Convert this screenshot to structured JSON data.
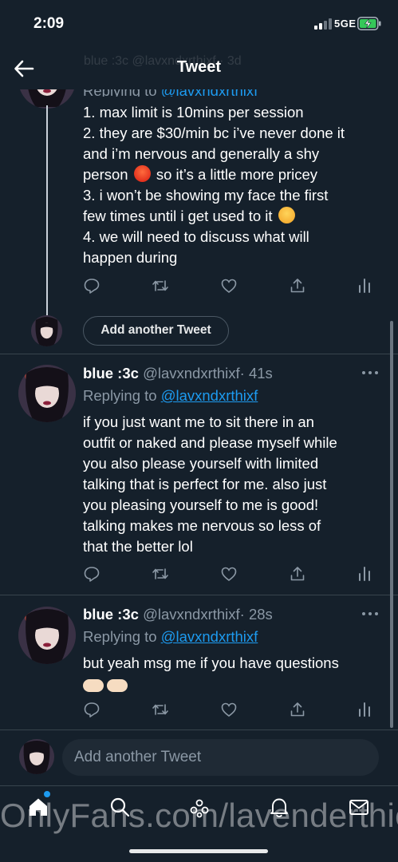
{
  "status_bar": {
    "time": "2:09",
    "network": "5GE"
  },
  "header": {
    "title": "Tweet",
    "ghost_text": "blue :3c @lavxndxrthixf · 3d"
  },
  "thread": {
    "replying_prefix": "Replying to",
    "replying_handle": "@lavxndxrthixf",
    "lines": [
      "1. max limit is 10mins per session",
      "2. they are $30/min bc i’ve never done it",
      "and i’m nervous and generally a shy",
      "person",
      "so it’s a little more pricey",
      "3. i won’t be showing my face the first",
      "few times until i get used to it",
      "4. we will need to discuss what will",
      "happen during"
    ]
  },
  "add_another_pill": "Add another Tweet",
  "tweets": [
    {
      "name": "blue :3c",
      "handle": "@lavxndxrthixf",
      "time": "· 41s",
      "replying_prefix": "Replying to",
      "replying_handle": "@lavxndxrthixf",
      "lines": [
        "if you just want me to sit there in an",
        "outfit or naked and please myself while",
        "you also please yourself with limited",
        "talking that is perfect for me. also just",
        "you pleasing yourself to me is good!",
        "talking makes me nervous so less of",
        "that the better lol"
      ]
    },
    {
      "name": "blue :3c",
      "handle": "@lavxndxrthixf",
      "time": "· 28s",
      "replying_prefix": "Replying to",
      "replying_handle": "@lavxndxrthixf",
      "lines": [
        "but yeah msg me if you have questions"
      ]
    }
  ],
  "compose": {
    "placeholder": "Add another Tweet"
  },
  "tabs": [
    "home-icon",
    "search-icon",
    "spaces-icon",
    "notifications-icon",
    "messages-icon"
  ],
  "watermark": "OnlyFans.com/lavenderthief",
  "colors": {
    "background": "#15202b",
    "accent": "#1d9bf0",
    "muted": "#8b98a5",
    "divider": "#38444d"
  }
}
